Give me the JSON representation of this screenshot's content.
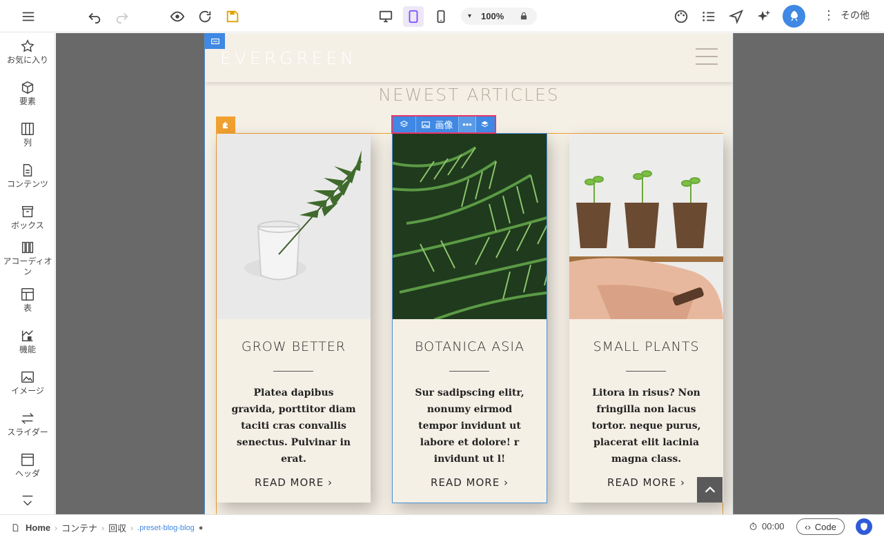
{
  "toolbar": {
    "zoom": "100%",
    "more_label": "その他"
  },
  "sidebar": {
    "items": [
      {
        "label": "お気に入り",
        "icon": "star-icon"
      },
      {
        "label": "要素",
        "icon": "cube-icon"
      },
      {
        "label": "列",
        "icon": "columns-icon"
      },
      {
        "label": "コンテンツ",
        "icon": "document-icon"
      },
      {
        "label": "ボックス",
        "icon": "box-icon"
      },
      {
        "label": "アコーディオン",
        "icon": "accordion-icon"
      },
      {
        "label": "表",
        "icon": "table-icon"
      },
      {
        "label": "機能",
        "icon": "features-icon"
      },
      {
        "label": "イメージ",
        "icon": "image-icon"
      },
      {
        "label": "スライダー",
        "icon": "slider-icon"
      },
      {
        "label": "ヘッダ",
        "icon": "header-icon"
      }
    ]
  },
  "site": {
    "logo": "EVERGREEN",
    "section_title": "NEWEST ARTICLES"
  },
  "image_toolbar": {
    "label": "画像"
  },
  "cards": [
    {
      "title": "GROW BETTER",
      "text": "Platea dapibus gravida, porttitor diam taciti cras convallis senectus. Pulvinar in erat.",
      "link": "READ MORE ›"
    },
    {
      "title": "BOTANICA ASIA",
      "text": "Sur sadipscing elitr, nonumy eirmod tempor invidunt ut labore et dolore! r invidunt ut l!",
      "link": "READ MORE ›"
    },
    {
      "title": "SMALL PLANTS",
      "text": "Litora in risus? Non fringilla non lacus tortor. neque purus, placerat elit lacinia magna class.",
      "link": "READ MORE ›"
    }
  ],
  "statusbar": {
    "breadcrumbs": [
      "Home",
      "コンテナ",
      "回収",
      ".preset-blog-blog"
    ],
    "timer": "00:00",
    "code_label": "Code"
  },
  "colors": {
    "accent": "#3f88e3",
    "gallery_border": "#f0a030",
    "selection_border": "#e8366a",
    "page_bg": "#f5f0e6"
  }
}
